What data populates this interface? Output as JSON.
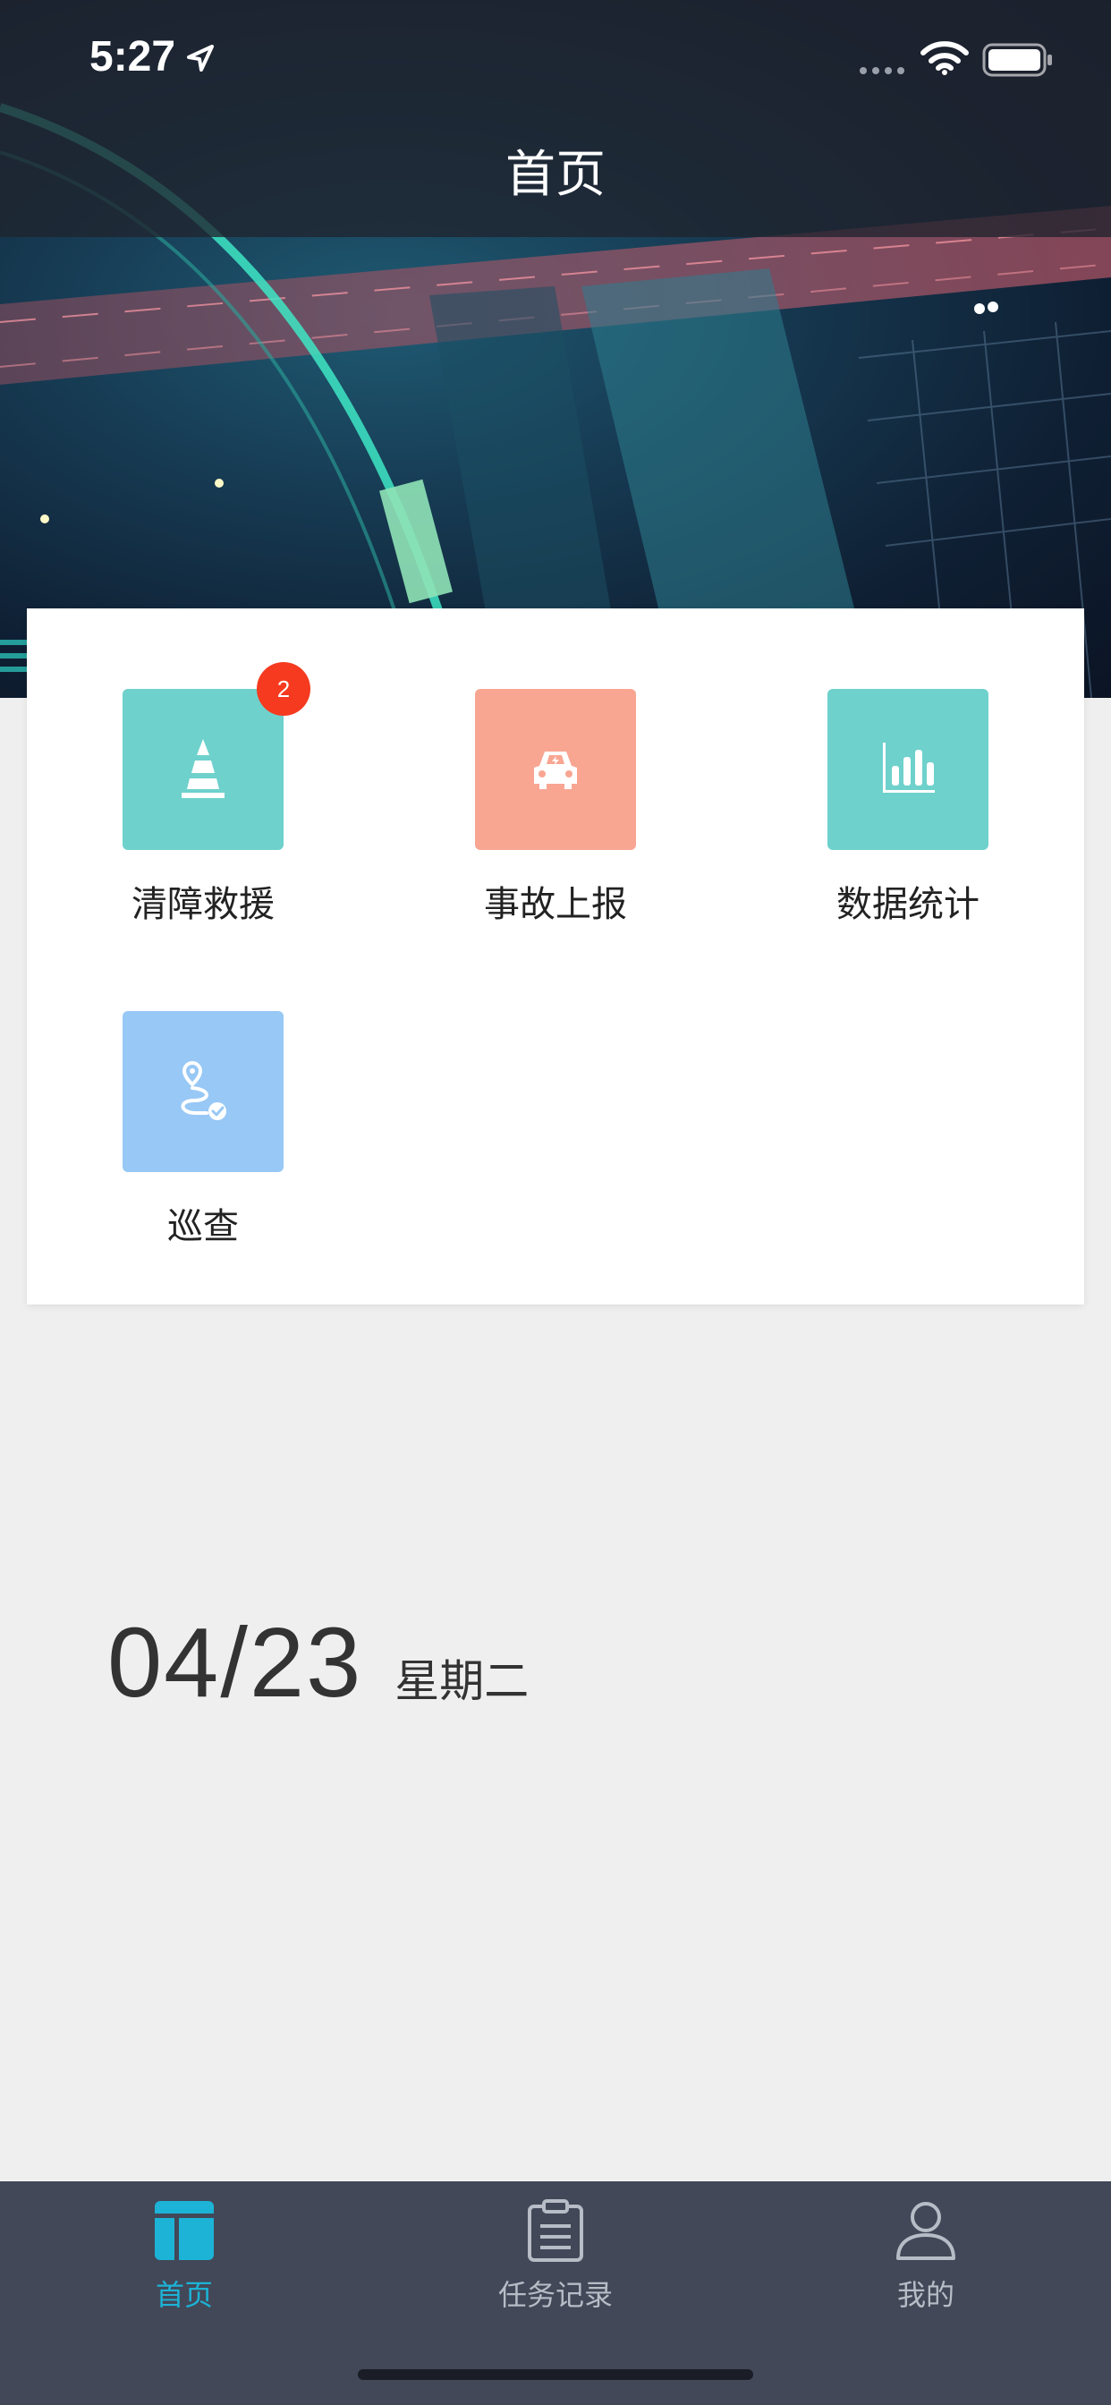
{
  "status_bar": {
    "time": "5:27"
  },
  "header": {
    "title": "首页"
  },
  "menu": {
    "items": [
      {
        "label": "清障救援",
        "icon": "traffic-cone-icon",
        "color": "#6ed1cc",
        "badge": "2"
      },
      {
        "label": "事故上报",
        "icon": "car-accident-icon",
        "color": "#f8a692"
      },
      {
        "label": "数据统计",
        "icon": "bar-chart-icon",
        "color": "#6ed1cc"
      },
      {
        "label": "巡查",
        "icon": "route-check-icon",
        "color": "#98c8f5"
      }
    ]
  },
  "date": {
    "day": "04/23",
    "weekday": "星期二"
  },
  "tabbar": {
    "active_color": "#1cb3d6",
    "inactive_color": "#b7bcc6",
    "tabs": [
      {
        "label": "首页",
        "icon": "home-grid-icon",
        "active": true
      },
      {
        "label": "任务记录",
        "icon": "clipboard-icon",
        "active": false
      },
      {
        "label": "我的",
        "icon": "user-icon",
        "active": false
      }
    ]
  }
}
